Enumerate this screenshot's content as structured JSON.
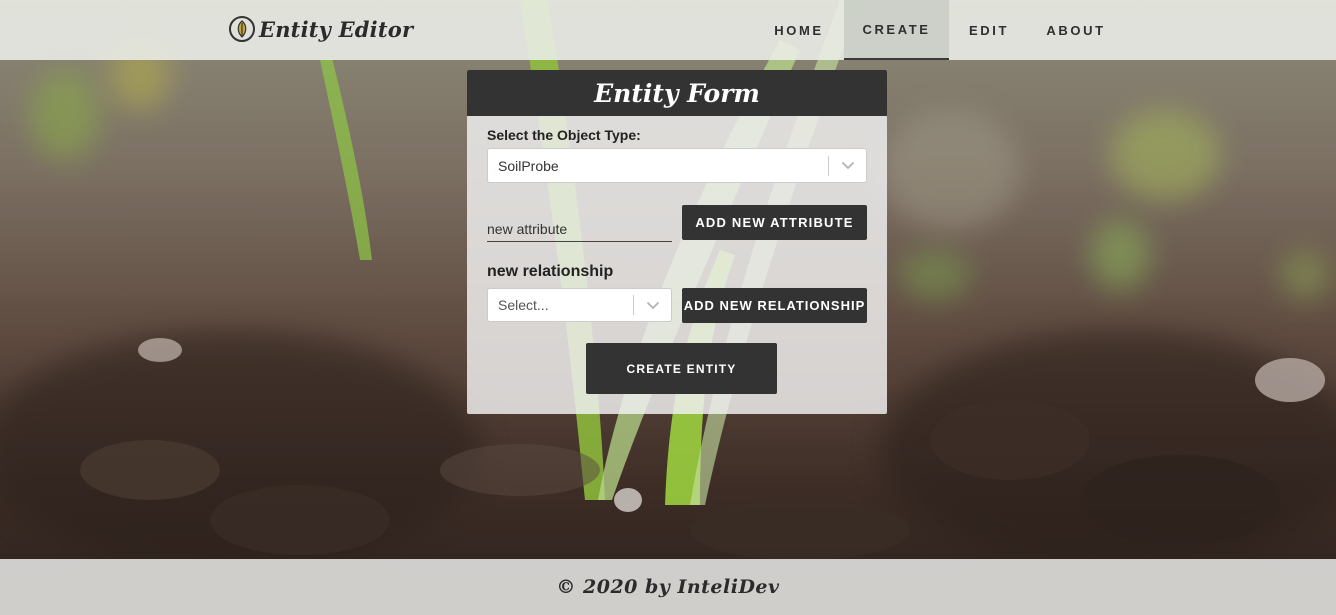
{
  "app": {
    "title": "Entity Editor",
    "logo_icon": "leaf-badge-icon"
  },
  "nav": {
    "items": [
      {
        "label": "HOME",
        "active": false
      },
      {
        "label": "CREATE",
        "active": true
      },
      {
        "label": "EDIT",
        "active": false
      },
      {
        "label": "ABOUT",
        "active": false
      }
    ]
  },
  "form": {
    "title": "Entity Form",
    "object_type_label": "Select the Object Type:",
    "object_type_value": "SoilProbe",
    "attribute_input_value": "new attribute",
    "add_attribute_label": "ADD NEW ATTRIBUTE",
    "relationship_label": "new relationship",
    "relationship_placeholder": "Select...",
    "add_relationship_label": "ADD NEW RELATIONSHIP",
    "create_label": "CREATE ENTITY",
    "dropdown_icon": "chevron-down-icon"
  },
  "footer": {
    "text": "© 2020 by InteliDev"
  },
  "colors": {
    "dark": "#333333",
    "header_bg": "#eceee8",
    "card_bg": "#f0f0f0"
  }
}
